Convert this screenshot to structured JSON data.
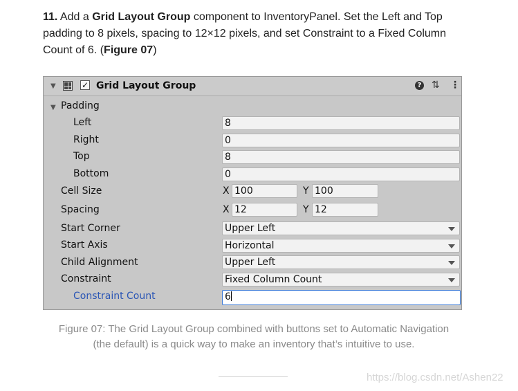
{
  "step": {
    "number": "11.",
    "t1": " Add a ",
    "b1": "Grid Layout Group",
    "t2": " component to InventoryPanel. Set the Left and Top padding to 8 pixels, spacing to 12×12 pixels, and set Constraint to a Fixed Column Count of 6. (",
    "b2": "Figure 07",
    "t3": ")"
  },
  "component": {
    "title": "Grid Layout Group",
    "enabled": true,
    "icons": {
      "help": "?",
      "settings": "⇅",
      "more": "⋮"
    }
  },
  "padding": {
    "label": "Padding",
    "left_label": "Left",
    "left": "8",
    "right_label": "Right",
    "right": "0",
    "top_label": "Top",
    "top": "8",
    "bottom_label": "Bottom",
    "bottom": "0"
  },
  "cell_size": {
    "label": "Cell Size",
    "x_label": "X",
    "x": "100",
    "y_label": "Y",
    "y": "100"
  },
  "spacing": {
    "label": "Spacing",
    "x_label": "X",
    "x": "12",
    "y_label": "Y",
    "y": "12"
  },
  "start_corner": {
    "label": "Start Corner",
    "value": "Upper Left"
  },
  "start_axis": {
    "label": "Start Axis",
    "value": "Horizontal"
  },
  "child_alignment": {
    "label": "Child Alignment",
    "value": "Upper Left"
  },
  "constraint": {
    "label": "Constraint",
    "value": "Fixed Column Count"
  },
  "constraint_count": {
    "label": "Constraint Count",
    "value": "6"
  },
  "caption": "Figure 07: The Grid Layout Group combined with buttons set to Automatic Navigation (the default) is a quick way to make an inventory that’s intuitive to use.",
  "watermark": "https://blog.csdn.net/Ashen22",
  "colors": {
    "accent": "#2b56b5",
    "focus": "#3a79d6",
    "panel": "#c8c8c8"
  }
}
